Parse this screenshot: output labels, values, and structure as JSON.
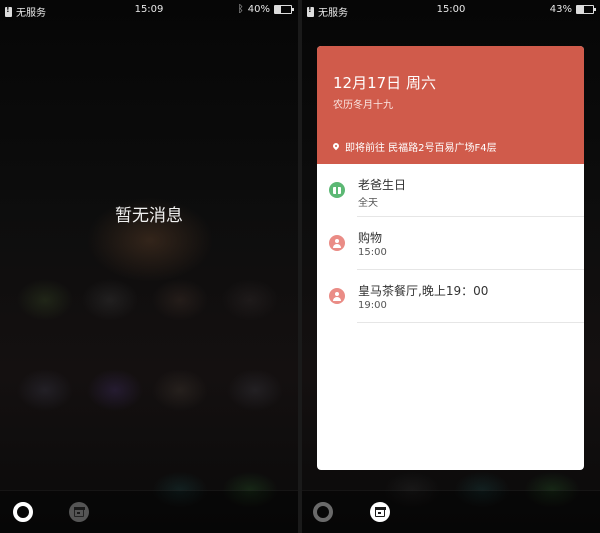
{
  "left_screen": {
    "status": {
      "carrier": "无服务",
      "time": "15:09",
      "battery": "40%",
      "battery_level": 0.4
    },
    "empty_text": "暂无消息"
  },
  "right_screen": {
    "status": {
      "carrier": "无服务",
      "time": "15:00",
      "battery": "43%",
      "battery_level": 0.43
    },
    "card": {
      "date": "12月17日 周六",
      "lunar": "农历冬月十九",
      "location": "即将前往 民福路2号百易广场F4层",
      "events": [
        {
          "title": "老爸生日",
          "sub": "全天",
          "icon": "gift-icon",
          "color": "#5cb874"
        },
        {
          "title": "购物",
          "sub": "15:00",
          "icon": "person-icon",
          "color": "#ea8c86"
        },
        {
          "title": "皇马茶餐厅,晚上19：00",
          "sub": "19:00",
          "icon": "person-icon",
          "color": "#ea8c86"
        }
      ]
    }
  },
  "colors": {
    "card_header": "#d05b4b"
  }
}
